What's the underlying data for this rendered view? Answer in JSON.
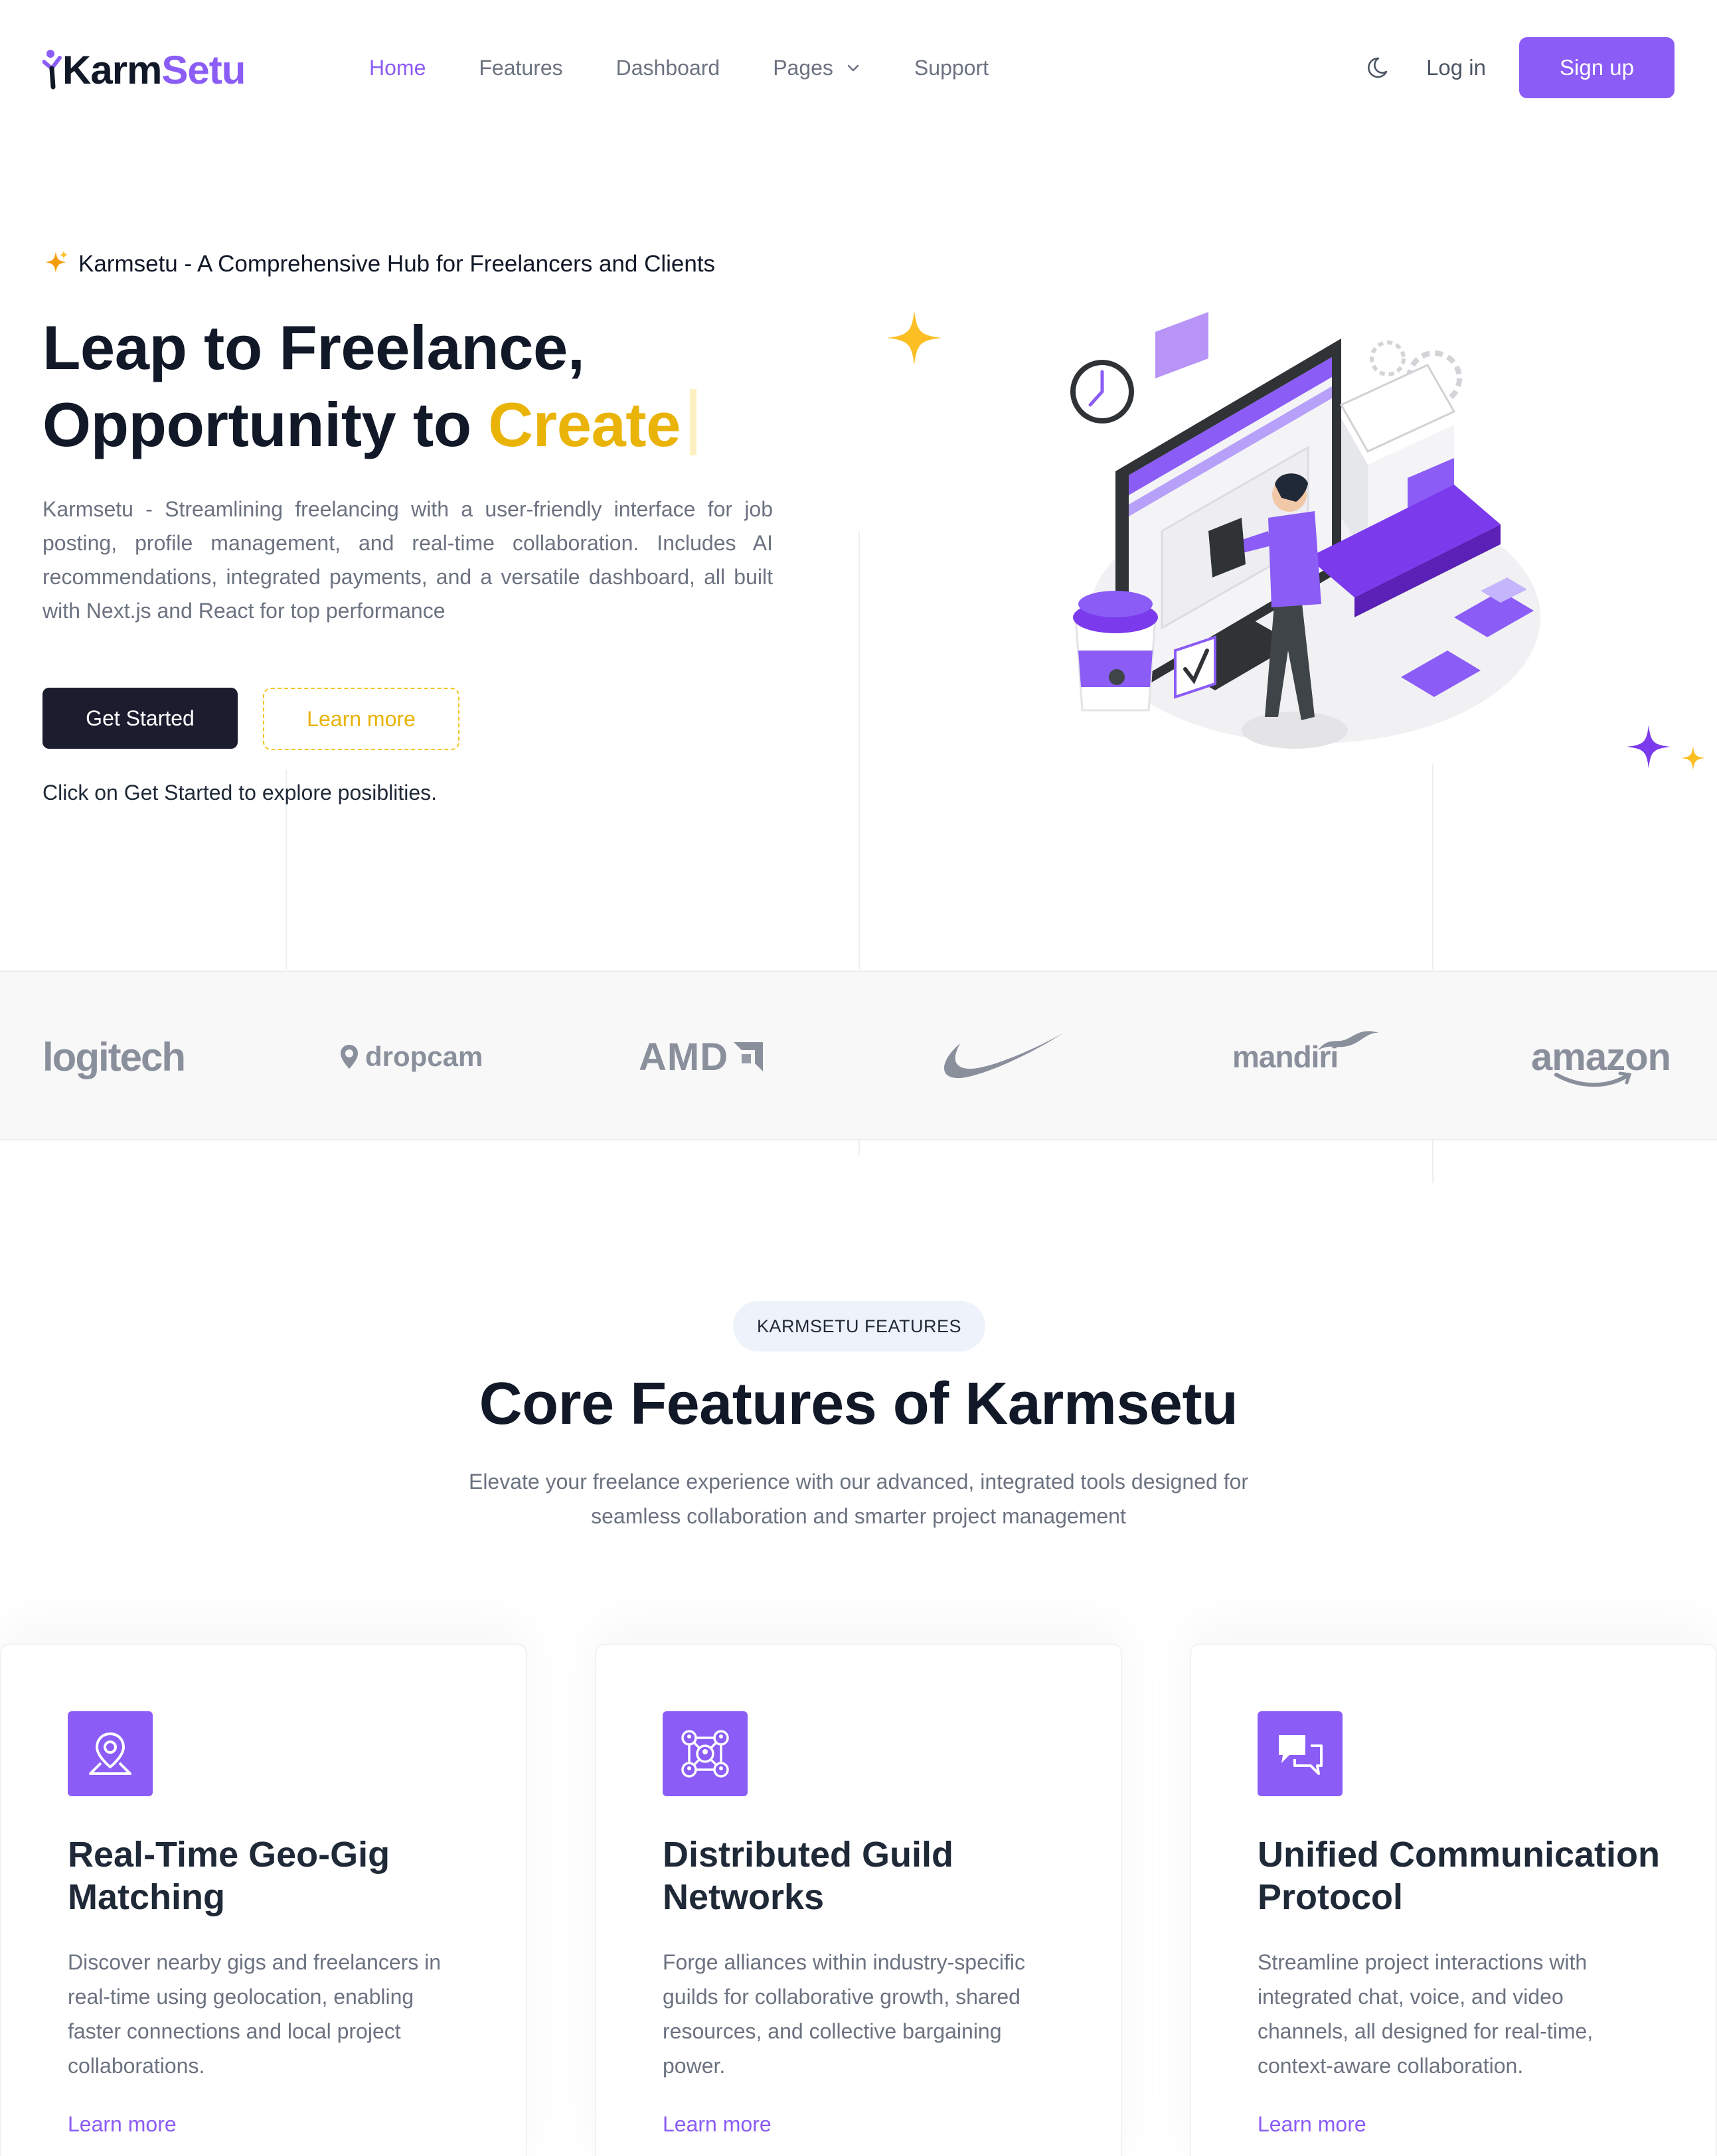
{
  "brand": {
    "name_part1": "Karm",
    "name_part2": "Setu"
  },
  "nav": [
    {
      "label": "Home",
      "active": true
    },
    {
      "label": "Features",
      "active": false
    },
    {
      "label": "Dashboard",
      "active": false
    },
    {
      "label": "Pages",
      "active": false,
      "has_dropdown": true
    },
    {
      "label": "Support",
      "active": false
    }
  ],
  "header_actions": {
    "theme_icon": "moon-icon",
    "login_label": "Log in",
    "signup_label": "Sign up"
  },
  "hero": {
    "eyebrow": "Karmsetu - A Comprehensive Hub for Freelancers and Clients",
    "title_line1": "Leap to Freelance,",
    "title_line2_prefix": "Opportunity to ",
    "title_highlight": "Create",
    "description": "Karmsetu - Streamlining freelancing with a user-friendly interface for job posting, profile management, and real-time collaboration. Includes AI recommendations, integrated payments, and a versatile dashboard, all built with Next.js and React for top performance",
    "primary_button": "Get Started",
    "secondary_button": "Learn more",
    "hint": "Click on Get Started to explore posiblities."
  },
  "brand_logos": {
    "logitech": "logitech",
    "dropcam": "dropcam",
    "amd": "AMD",
    "mandiri": "mandiri",
    "amazon": "amazon"
  },
  "features": {
    "badge": "KARMSETU FEATURES",
    "title": "Core Features of Karmsetu",
    "subtitle": "Elevate your freelance experience with our advanced, integrated tools designed for seamless collaboration and smarter project management",
    "cards": [
      {
        "icon": "map-pin-icon",
        "title": "Real-Time Geo-Gig Matching",
        "description": "Discover nearby gigs and freelancers in real-time using geolocation, enabling faster connections and local project collaborations.",
        "link": "Learn more"
      },
      {
        "icon": "network-icon",
        "title": "Distributed Guild Networks",
        "description": "Forge alliances within industry-specific guilds for collaborative growth, shared resources, and collective bargaining power.",
        "link": "Learn more"
      },
      {
        "icon": "chat-icon",
        "title": "Unified Communication Protocol",
        "description": "Streamline project interactions with integrated chat, voice, and video channels, all designed for real-time, context-aware collaboration.",
        "link": "Learn more"
      }
    ]
  },
  "colors": {
    "accent": "#8b5cf6",
    "highlight": "#eab308",
    "dark": "#1b1d2f"
  }
}
